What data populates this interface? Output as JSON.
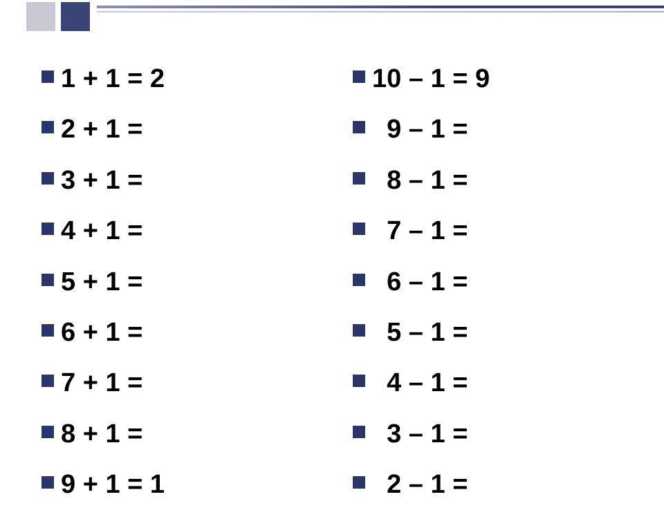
{
  "left": {
    "items": [
      "1 + 1 = 2",
      "2 + 1 =",
      "3 + 1 =",
      "4 + 1 =",
      "5 + 1 =",
      "6 + 1 =",
      "7 + 1 =",
      "8 + 1 =",
      "9 + 1 = 1"
    ]
  },
  "right": {
    "items": [
      "10 – 1 = 9",
      "  9 – 1 =",
      "  8 – 1 =",
      "  7 – 1 =",
      "  6 – 1 =",
      "  5 – 1 =",
      "  4 – 1 =",
      "  3 – 1 =",
      "  2 – 1 ="
    ]
  }
}
